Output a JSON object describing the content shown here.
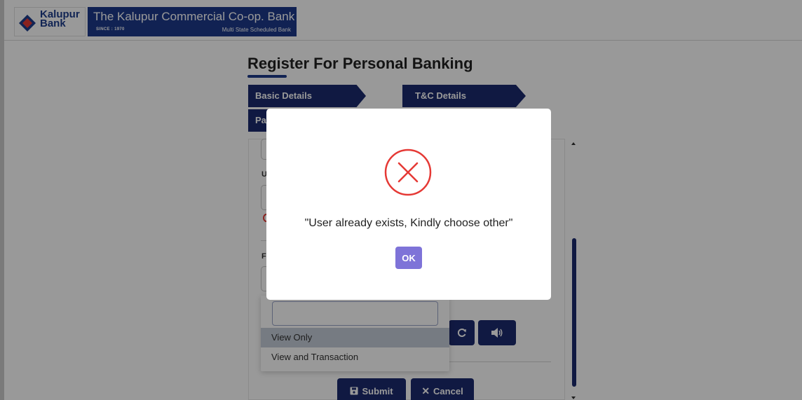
{
  "header": {
    "logo_text_line1": "Kalupur",
    "logo_text_line2": "Bank",
    "bank_name": "The Kalupur Commercial Co-op. Bank Ltd.",
    "since": "SINCE : 1970",
    "subtitle": "Multi State Scheduled Bank"
  },
  "page": {
    "title": "Register For Personal Banking"
  },
  "steps": [
    {
      "label": "Basic Details"
    },
    {
      "label": "T&C Details"
    },
    {
      "label": "Pa"
    }
  ],
  "form": {
    "label_1": "U",
    "label_2": "F"
  },
  "dropdown": {
    "search_value": "",
    "options": [
      "View Only",
      "View and Transaction"
    ],
    "selected": "View Only"
  },
  "captcha": {
    "refresh_icon": "refresh-icon",
    "audio_icon": "speaker-icon"
  },
  "actions": {
    "submit_label": "Submit",
    "cancel_label": "Cancel"
  },
  "modal": {
    "message": "\"User already exists, Kindly choose other\"",
    "ok_label": "OK",
    "icon": "error-circle-x-icon"
  },
  "colors": {
    "brand_navy": "#1c2a6e",
    "ok_purple": "#7e73d8",
    "error_red": "#e53935"
  }
}
